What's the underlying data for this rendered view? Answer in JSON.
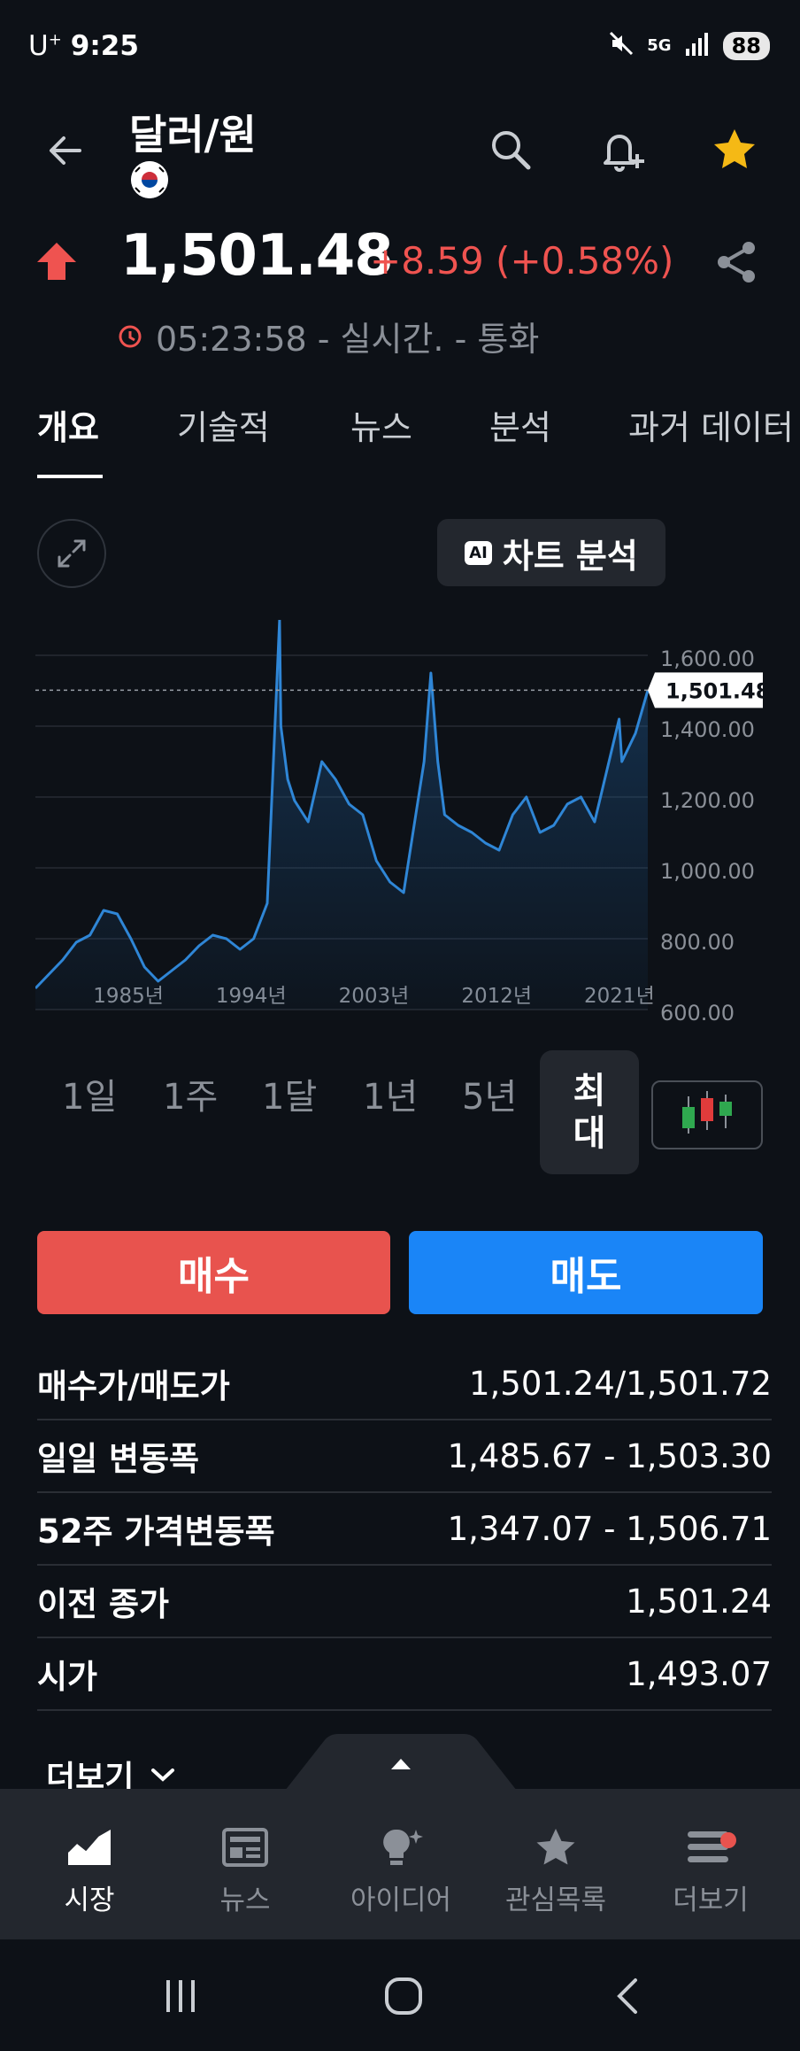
{
  "status_bar": {
    "carrier": "U",
    "carrier_sup": "+",
    "time": "9:25",
    "network": "5G",
    "battery": "88"
  },
  "header": {
    "title": "달러/원",
    "flag": "south-korea-flag"
  },
  "quote": {
    "price": "1,501.48",
    "change": "+8.59 (+0.58%)",
    "time_info": "05:23:58 - 실시간. - 통화",
    "up_color": "#ef5350"
  },
  "tabs": [
    "개요",
    "기술적",
    "뉴스",
    "분석",
    "과거 데이터"
  ],
  "chart_tools": {
    "ai_badge": "AI",
    "ai_label": "차트 분석"
  },
  "chart_data": {
    "type": "area",
    "x_tick_labels": [
      "1985년",
      "1994년",
      "2003년",
      "2012년",
      "2021년"
    ],
    "y_tick_labels": [
      "600.00",
      "800.00",
      "1,000.00",
      "1,200.00",
      "1,400.00",
      "1,600.00"
    ],
    "ylim": [
      600,
      1700
    ],
    "current_value_label": "1,501.48",
    "current_value": 1501.48,
    "x": [
      1980,
      1981,
      1982,
      1983,
      1984,
      1985,
      1986,
      1987,
      1988,
      1989,
      1990,
      1991,
      1992,
      1993,
      1994,
      1995,
      1996,
      1997,
      1997.9,
      1998,
      1998.5,
      1999,
      2000,
      2001,
      2002,
      2003,
      2004,
      2005,
      2006,
      2007,
      2008.5,
      2009,
      2009.5,
      2010,
      2011,
      2012,
      2013,
      2014,
      2015,
      2016,
      2017,
      2018,
      2019,
      2020,
      2021,
      2022.8,
      2023,
      2024,
      2024.9
    ],
    "values": [
      660,
      700,
      740,
      790,
      810,
      880,
      870,
      800,
      720,
      680,
      710,
      740,
      780,
      810,
      800,
      770,
      800,
      900,
      1700,
      1400,
      1250,
      1190,
      1130,
      1300,
      1250,
      1180,
      1150,
      1020,
      960,
      930,
      1300,
      1550,
      1300,
      1150,
      1120,
      1100,
      1070,
      1050,
      1150,
      1200,
      1100,
      1120,
      1180,
      1200,
      1130,
      1420,
      1300,
      1380,
      1501
    ],
    "line_color": "#2f86d6",
    "grid": "on"
  },
  "ranges": [
    "1일",
    "1주",
    "1달",
    "1년",
    "5년"
  ],
  "active_range": [
    "최",
    "대"
  ],
  "actions": {
    "buy": "매수",
    "sell": "매도",
    "buy_color": "#e8534e",
    "sell_color": "#1a85f7"
  },
  "stats": [
    {
      "label": "매수가/매도가",
      "value": "1,501.24/1,501.72"
    },
    {
      "label": "일일 변동폭",
      "value": "1,485.67 - 1,503.30"
    },
    {
      "label": "52주 가격변동폭",
      "value": "1,347.07 - 1,506.71"
    },
    {
      "label": "이전 종가",
      "value": "1,501.24"
    },
    {
      "label": "시가",
      "value": "1,493.07"
    }
  ],
  "more_label": "더보기",
  "bottom_nav": [
    {
      "label": "시장",
      "icon": "market-chart-icon"
    },
    {
      "label": "뉴스",
      "icon": "news-icon"
    },
    {
      "label": "아이디어",
      "icon": "idea-bulb-icon"
    },
    {
      "label": "관심목록",
      "icon": "star-icon"
    },
    {
      "label": "더보기",
      "icon": "menu-icon"
    }
  ]
}
